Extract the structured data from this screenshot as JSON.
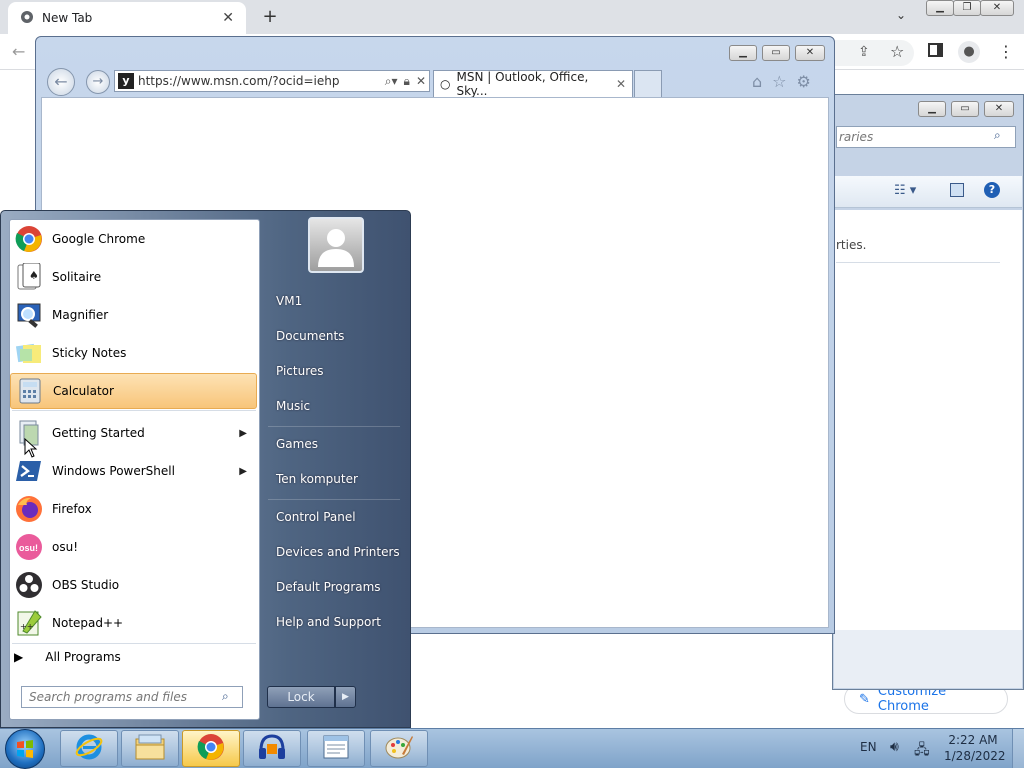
{
  "chrome": {
    "tab_title": "New Tab",
    "tab_close": "✕",
    "new_tab": "+",
    "customize_label": "Customize Chrome"
  },
  "explorer": {
    "search_placeholder": "raries",
    "content_text": "rties."
  },
  "ie": {
    "address": "https://www.msn.com/?ocid=iehp",
    "tab_title": "MSN | Outlook, Office, Sky...",
    "tab_close": "✕"
  },
  "start_menu": {
    "programs": [
      {
        "label": "Google Chrome",
        "icon": "chrome-icon"
      },
      {
        "label": "Solitaire",
        "icon": "solitaire-icon"
      },
      {
        "label": "Magnifier",
        "icon": "magnifier-icon"
      },
      {
        "label": "Sticky Notes",
        "icon": "sticky-notes-icon"
      },
      {
        "label": "Calculator",
        "icon": "calculator-icon",
        "highlighted": true
      },
      {
        "label": "Getting Started",
        "icon": "getting-started-icon",
        "submenu": true
      },
      {
        "label": "Windows PowerShell",
        "icon": "powershell-icon",
        "submenu": true
      },
      {
        "label": "Firefox",
        "icon": "firefox-icon"
      },
      {
        "label": "osu!",
        "icon": "osu-icon"
      },
      {
        "label": "OBS Studio",
        "icon": "obs-icon"
      },
      {
        "label": "Notepad++",
        "icon": "notepadpp-icon"
      }
    ],
    "all_programs": "All Programs",
    "search_placeholder": "Search programs and files",
    "right_links": [
      "VM1",
      "Documents",
      "Pictures",
      "Music",
      "Games",
      "Ten komputer",
      "Control Panel",
      "Devices and Printers",
      "Default Programs",
      "Help and Support"
    ],
    "lock_label": "Lock"
  },
  "taskbar": {
    "apps": [
      "internet-explorer-icon",
      "file-explorer-icon",
      "chrome-icon",
      "audacity-icon",
      "notepad-icon",
      "paint-icon"
    ],
    "language": "EN",
    "time": "2:22 AM",
    "date": "1/28/2022"
  }
}
